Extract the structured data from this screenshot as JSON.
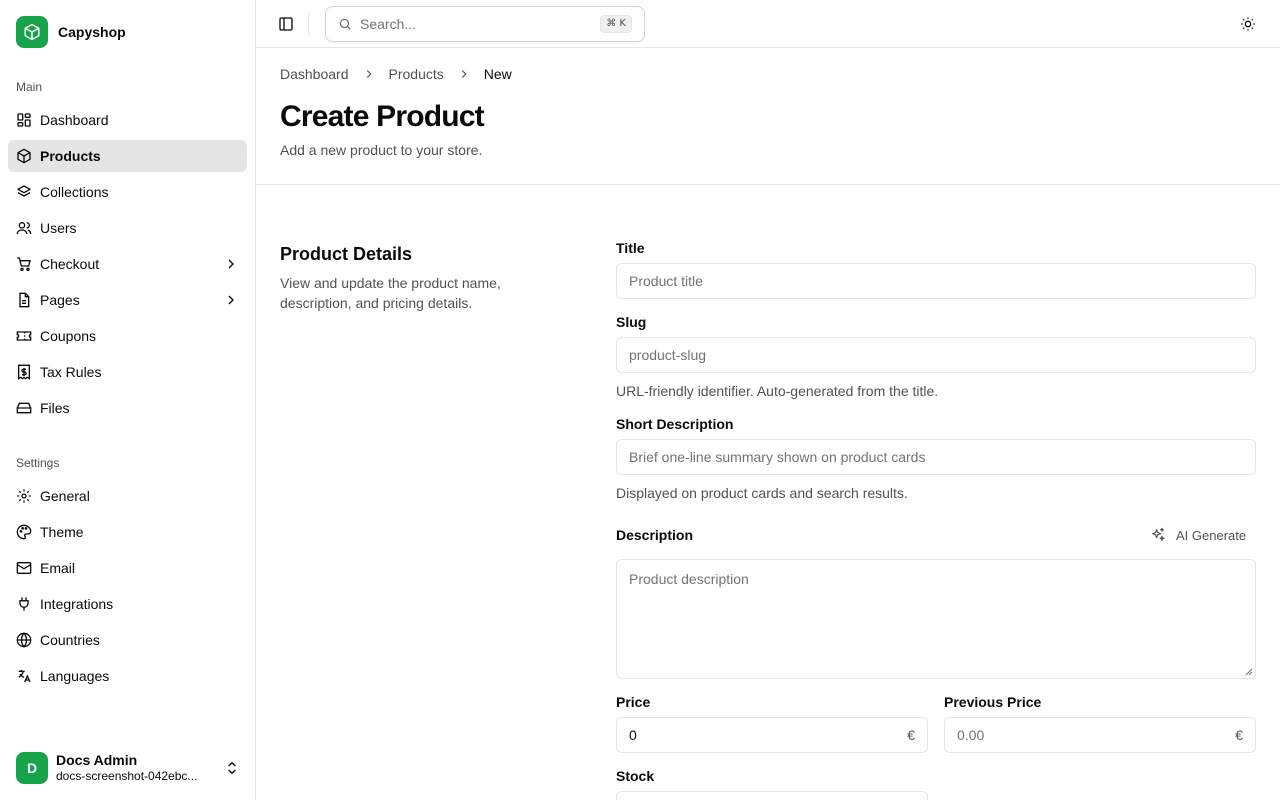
{
  "app": {
    "name": "Capyshop"
  },
  "sidebar": {
    "main_label": "Main",
    "main_items": [
      {
        "label": "Dashboard",
        "icon": "layout-dashboard-icon"
      },
      {
        "label": "Products",
        "icon": "package-icon",
        "active": true
      },
      {
        "label": "Collections",
        "icon": "layers-icon"
      },
      {
        "label": "Users",
        "icon": "users-icon"
      },
      {
        "label": "Checkout",
        "icon": "shopping-cart-icon",
        "expandable": true
      },
      {
        "label": "Pages",
        "icon": "file-text-icon",
        "expandable": true
      },
      {
        "label": "Coupons",
        "icon": "ticket-icon"
      },
      {
        "label": "Tax Rules",
        "icon": "receipt-icon"
      },
      {
        "label": "Files",
        "icon": "hard-drive-icon"
      }
    ],
    "settings_label": "Settings",
    "settings_items": [
      {
        "label": "General",
        "icon": "gear-icon"
      },
      {
        "label": "Theme",
        "icon": "palette-icon"
      },
      {
        "label": "Email",
        "icon": "mail-icon"
      },
      {
        "label": "Integrations",
        "icon": "plug-icon"
      },
      {
        "label": "Countries",
        "icon": "globe-icon"
      },
      {
        "label": "Languages",
        "icon": "languages-icon"
      }
    ],
    "user": {
      "initial": "D",
      "name": "Docs Admin",
      "email": "docs-screenshot-042ebc..."
    }
  },
  "header": {
    "search_placeholder": "Search...",
    "search_shortcut": "⌘ K"
  },
  "breadcrumb": [
    "Dashboard",
    "Products",
    "New"
  ],
  "page": {
    "title": "Create Product",
    "subtitle": "Add a new product to your store."
  },
  "section": {
    "title": "Product Details",
    "description": "View and update the product name, description, and pricing details."
  },
  "form": {
    "title_label": "Title",
    "title_placeholder": "Product title",
    "slug_label": "Slug",
    "slug_placeholder": "product-slug",
    "slug_help": "URL-friendly identifier. Auto-generated from the title.",
    "short_desc_label": "Short Description",
    "short_desc_placeholder": "Brief one-line summary shown on product cards",
    "short_desc_help": "Displayed on product cards and search results.",
    "desc_label": "Description",
    "ai_generate": "AI Generate",
    "desc_placeholder": "Product description",
    "price_label": "Price",
    "price_value": "0",
    "currency": "€",
    "prev_price_label": "Previous Price",
    "prev_price_placeholder": "0.00",
    "stock_label": "Stock"
  },
  "colors": {
    "brand": "#16a34a",
    "active_bg": "#e5e5e5",
    "border": "#e5e5e5",
    "muted_text": "#525252"
  }
}
